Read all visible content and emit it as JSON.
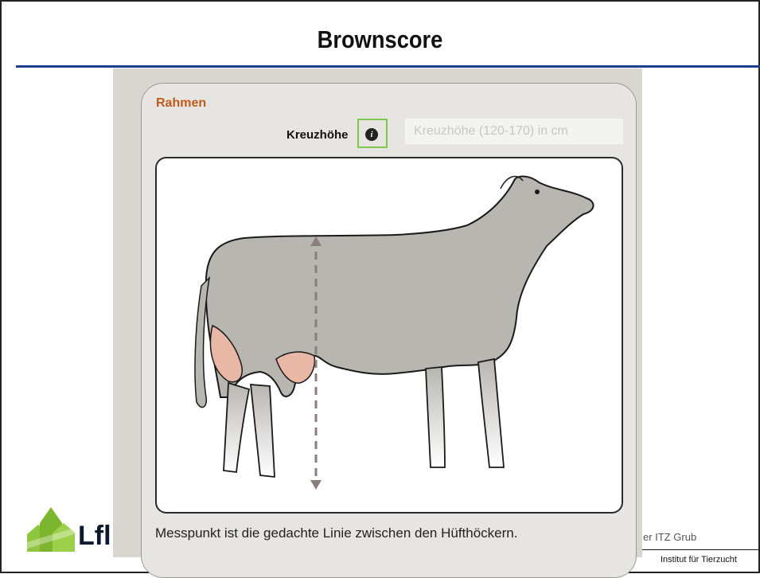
{
  "slide": {
    "title": "Brownscore",
    "logo_text": "Lfl",
    "footer_left": "er ITZ Grub",
    "footer_right": "Institut für Tierzucht"
  },
  "form": {
    "section_title": "Rahmen",
    "field_label": "Kreuzhöhe",
    "info_icon_glyph": "i",
    "input_placeholder": "Kreuzhöhe (120-170) in cm",
    "input_value": "",
    "caption": "Messpunkt ist die gedachte Linie zwischen den Hüfthöckern."
  },
  "colors": {
    "title_rule": "#1d3f8f",
    "section_title": "#c05a1c",
    "info_highlight": "#7ec850",
    "cow_body": "#b7b6b1",
    "udder": "#e8b7a5",
    "measure_line": "#8a7f7a"
  },
  "icons": {
    "info": "info-circle-icon",
    "logo": "lfl-leaf-logo-icon"
  }
}
